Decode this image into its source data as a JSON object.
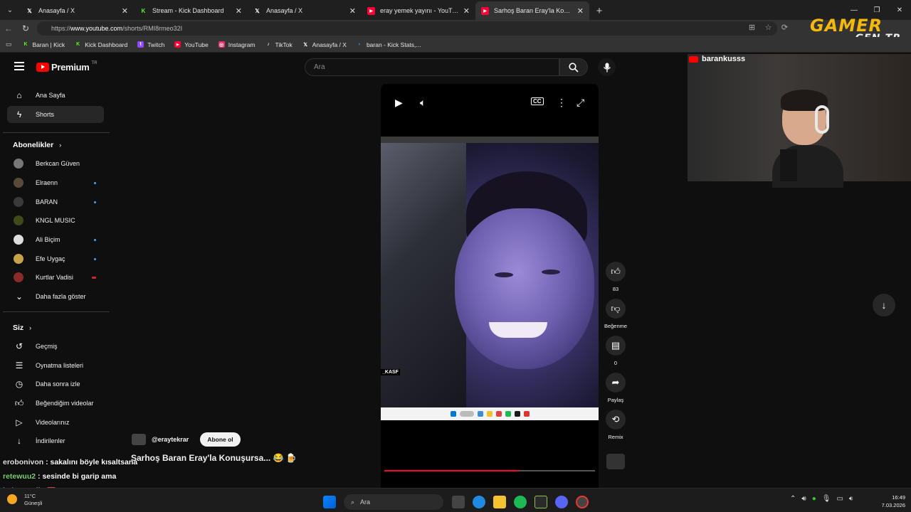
{
  "browser": {
    "tabs": [
      {
        "title": "Anasayfa / X",
        "icon": "x-icon",
        "color": "#ffffff"
      },
      {
        "title": "Stream - Kick Dashboard",
        "icon": "kick-icon",
        "color": "#53fc18"
      },
      {
        "title": "Anasayfa / X",
        "icon": "x-icon",
        "color": "#ffffff"
      },
      {
        "title": "eray yemek yayını - YouTube",
        "icon": "youtube-icon",
        "color": "#ff0033"
      },
      {
        "title": "Sarhoş Baran Eray'la Konuşursa...",
        "icon": "youtube-icon",
        "color": "#ff0033"
      }
    ],
    "url_prefix": "https://",
    "url_host": "www.youtube.com",
    "url_path": "/shorts/RMI8rmeo32I",
    "bookmarks": [
      {
        "label": "Baran | Kick",
        "color": "#53fc18",
        "glyph": "K"
      },
      {
        "label": "Kick Dashboard",
        "color": "#53fc18",
        "glyph": "K"
      },
      {
        "label": "Twitch",
        "color": "#9146ff",
        "glyph": "t"
      },
      {
        "label": "YouTube",
        "color": "#ff0033",
        "glyph": "▶"
      },
      {
        "label": "Instagram",
        "color": "#e1306c",
        "glyph": "◎"
      },
      {
        "label": "TikTok",
        "color": "#000000",
        "glyph": "♪"
      },
      {
        "label": "Anasayfa / X",
        "color": "#000000",
        "glyph": "X"
      },
      {
        "label": "baran - Kick Stats,...",
        "color": "#4a7bd0",
        "glyph": "◐"
      }
    ]
  },
  "overlay": {
    "logo_main": "GAMER",
    "logo_sub": "GEN.TR",
    "cam_channel": "barankusss"
  },
  "youtube": {
    "logo_text": "Premium",
    "logo_region": "TR",
    "search_placeholder": "Ara",
    "nav": [
      {
        "label": "Ana Sayfa",
        "icon": "home-icon"
      },
      {
        "label": "Shorts",
        "icon": "shorts-icon"
      }
    ],
    "subscriptions_heading": "Abonelikler",
    "subscriptions": [
      {
        "label": "Berkcan Güven",
        "color": "#777777",
        "new": false
      },
      {
        "label": "Elraenn",
        "color": "#5a4a3a",
        "new": true
      },
      {
        "label": "BARAN",
        "color": "#3a3a3a",
        "new": true
      },
      {
        "label": "KNGL MUSIC",
        "color": "#3f4a1a",
        "new": false
      },
      {
        "label": "Ali Biçim",
        "color": "#dddddd",
        "new": true
      },
      {
        "label": "Efe Uygaç",
        "color": "#c8a248",
        "new": true
      },
      {
        "label": "Kurtlar Vadisi",
        "color": "#8a2a2a",
        "new": true
      }
    ],
    "show_more": "Daha fazla göster",
    "you_heading": "Siz",
    "you_items": [
      {
        "label": "Geçmiş",
        "icon": "history-icon"
      },
      {
        "label": "Oynatma listeleri",
        "icon": "playlist-icon"
      },
      {
        "label": "Daha sonra izle",
        "icon": "watch-later-icon"
      },
      {
        "label": "Beğendiğim videolar",
        "icon": "liked-videos-icon"
      },
      {
        "label": "Videolarınız",
        "icon": "your-videos-icon"
      },
      {
        "label": "İndirilenler",
        "icon": "downloads-icon"
      }
    ],
    "short": {
      "channel": "@eraytekrar",
      "subscribe": "Abone ol",
      "title": "Sarhoş Baran Eray'la Konuşursa... 😂 🍺",
      "overlay_text": "_KASF",
      "progress": 0.64,
      "actions": [
        {
          "label": "83",
          "icon": "like-icon"
        },
        {
          "label": "Beğenme",
          "icon": "dislike-icon"
        },
        {
          "label": "0",
          "icon": "comment-icon"
        },
        {
          "label": "Paylaş",
          "icon": "share-icon"
        },
        {
          "label": "Remix",
          "icon": "remix-icon"
        }
      ]
    }
  },
  "chat": [
    {
      "user": "erobonivon",
      "message": ": sakalını böyle kısaltsana"
    },
    {
      "user": "retewuu2",
      "message": ": sesinde bi garip ama"
    },
    {
      "user": "kolpacartii",
      "message": ":"
    }
  ],
  "taskbar": {
    "temperature": "11°C",
    "weather": "Güneşli",
    "search": "Ara",
    "time": "16:49",
    "date": "7.03.2026"
  }
}
